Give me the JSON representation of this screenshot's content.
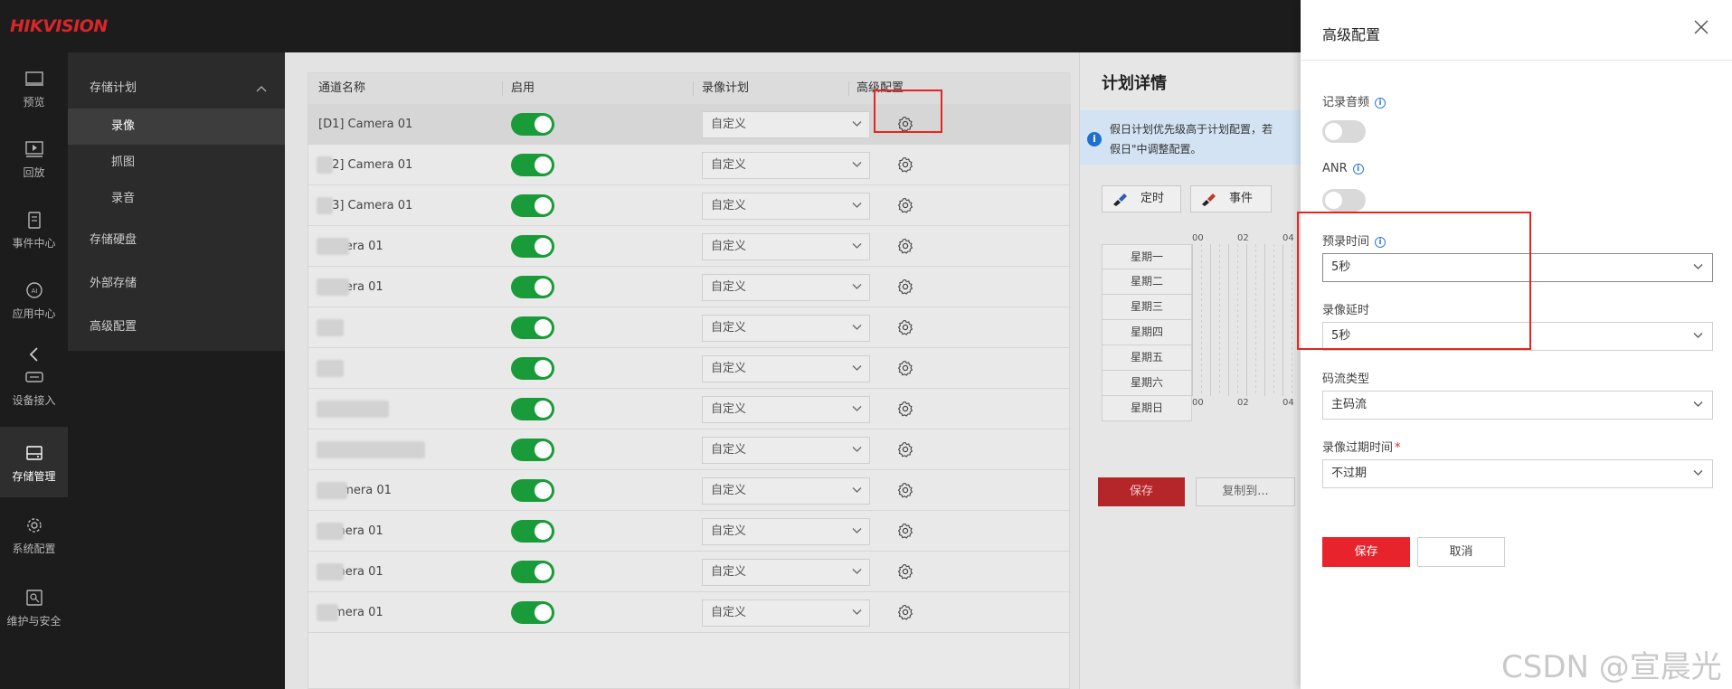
{
  "app": {
    "logo": "HIKVISION"
  },
  "nav": [
    {
      "label": "预览",
      "icon": "monitor-icon"
    },
    {
      "label": "回放",
      "icon": "playback-icon"
    },
    {
      "label": "事件中心",
      "icon": "clipboard-icon"
    },
    {
      "label": "应用中心",
      "icon": "ai-icon"
    },
    {
      "label": "设备接入",
      "icon": "device-icon"
    },
    {
      "label": "存储管理",
      "icon": "storage-icon",
      "active": true
    },
    {
      "label": "系统配置",
      "icon": "gear-icon"
    },
    {
      "label": "维护与安全",
      "icon": "maintenance-icon"
    }
  ],
  "submenu": {
    "group": "存储计划",
    "items": [
      "录像",
      "抓图",
      "录音"
    ],
    "active": "录像",
    "others": [
      "存储硬盘",
      "外部存储",
      "高级配置"
    ]
  },
  "table": {
    "headers": [
      "通道名称",
      "启用",
      "录像计划",
      "高级配置"
    ],
    "rows": [
      {
        "name": "[D1] Camera 01",
        "plan": "自定义"
      },
      {
        "name": "[D2] Camera 01",
        "plan": "自定义"
      },
      {
        "name": "[D3] Camera 01",
        "plan": "自定义"
      },
      {
        "name": "Camera 01",
        "plan": "自定义"
      },
      {
        "name": "Camera 01",
        "plan": "自定义"
      },
      {
        "name": "IPC",
        "plan": "自定义"
      },
      {
        "name": "IPC",
        "plan": "自定义"
      },
      {
        "name": "",
        "plan": "自定义"
      },
      {
        "name": "",
        "plan": "自定义"
      },
      {
        "name": "] Camera 01",
        "plan": "自定义"
      },
      {
        "name": "Camera 01",
        "plan": "自定义"
      },
      {
        "name": "Camera 01",
        "plan": "自定义"
      },
      {
        "name": "Camera 01",
        "plan": "自定义"
      }
    ]
  },
  "plan": {
    "title": "计划详情",
    "info": [
      "假日计划优先级高于计划配置，若",
      "假日\"中调整配置。"
    ],
    "btn_timing": "定时",
    "btn_event": "事件",
    "days": [
      "星期一",
      "星期二",
      "星期三",
      "星期四",
      "星期五",
      "星期六",
      "星期日"
    ],
    "ticks": [
      "00",
      "02",
      "04"
    ],
    "save": "保存",
    "copy": "复制到..."
  },
  "drawer": {
    "title": "高级配置",
    "record_audio": {
      "label": "记录音频",
      "enabled": false
    },
    "anr": {
      "label": "ANR",
      "enabled": false
    },
    "pre_record": {
      "label": "预录时间",
      "value": "5秒"
    },
    "post_record": {
      "label": "录像延时",
      "value": "5秒"
    },
    "stream_type": {
      "label": "码流类型",
      "value": "主码流"
    },
    "expire": {
      "label": "录像过期时间",
      "value": "不过期"
    },
    "save": "保存",
    "cancel": "取消"
  },
  "watermark": "CSDN @宣晨光",
  "colors": {
    "accent": "#e7232b",
    "toggle_on": "#1a9b39",
    "nav_bg": "#1c1c1c"
  }
}
